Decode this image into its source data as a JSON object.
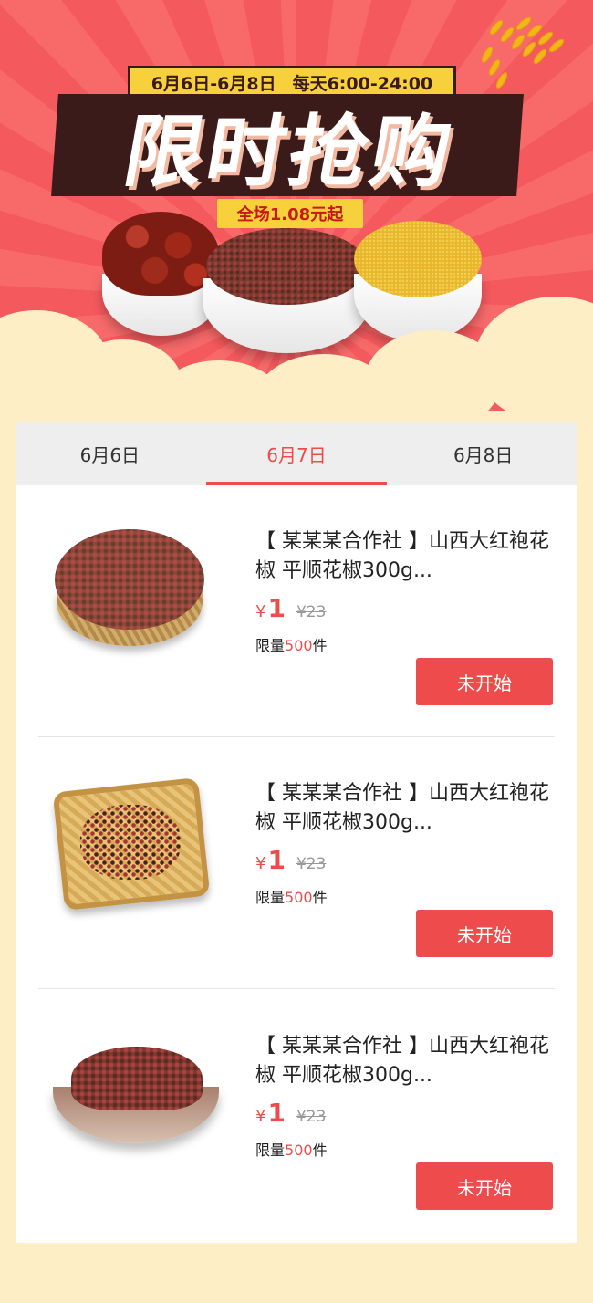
{
  "banner": {
    "date_range": "6月6日-6月8日",
    "time_range": "每天6:00-24:00",
    "title": "限时抢购",
    "promo": "全场1.08元起"
  },
  "tabs": [
    {
      "label": "6月6日",
      "active": false
    },
    {
      "label": "6月7日",
      "active": true
    },
    {
      "label": "6月8日",
      "active": false
    }
  ],
  "products": [
    {
      "name": "【 某某某合作社 】山西大红袍花椒 平顺花椒300g...",
      "currency": "¥",
      "price": "1",
      "original_price": "¥23",
      "limit_prefix": "限量",
      "limit_qty": "500",
      "limit_suffix": "件",
      "button": "未开始",
      "image": "basket-peppercorn"
    },
    {
      "name": "【 某某某合作社 】山西大红袍花椒 平顺花椒300g...",
      "currency": "¥",
      "price": "1",
      "original_price": "¥23",
      "limit_prefix": "限量",
      "limit_qty": "500",
      "limit_suffix": "件",
      "button": "未开始",
      "image": "tray-peppercorn"
    },
    {
      "name": "【 某某某合作社 】山西大红袍花椒 平顺花椒300g...",
      "currency": "¥",
      "price": "1",
      "original_price": "¥23",
      "limit_prefix": "限量",
      "limit_qty": "500",
      "limit_suffix": "件",
      "button": "未开始",
      "image": "bowl-peppercorn"
    }
  ],
  "colors": {
    "accent": "#ee4c4c",
    "banner_red": "#f4595d",
    "background": "#fdeec5",
    "yellow": "#f7d13b"
  }
}
